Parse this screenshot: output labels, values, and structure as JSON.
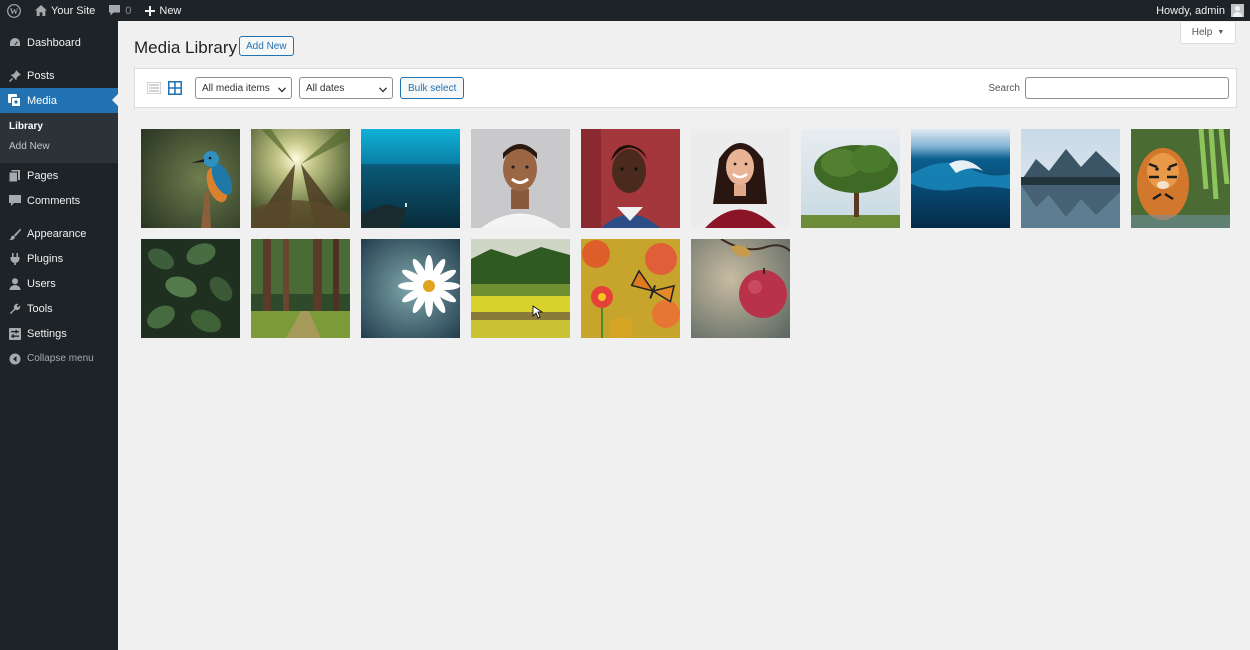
{
  "adminbar": {
    "site_name": "Your Site",
    "comments_count": "0",
    "new_label": "New",
    "howdy": "Howdy, admin"
  },
  "sidebar": {
    "items": [
      {
        "label": "Dashboard",
        "icon": "dashboard-icon"
      },
      {
        "label": "Posts",
        "icon": "pin-icon"
      },
      {
        "label": "Media",
        "icon": "media-icon",
        "active": true
      },
      {
        "label": "Pages",
        "icon": "page-icon"
      },
      {
        "label": "Comments",
        "icon": "comment-icon"
      },
      {
        "label": "Appearance",
        "icon": "brush-icon"
      },
      {
        "label": "Plugins",
        "icon": "plug-icon"
      },
      {
        "label": "Users",
        "icon": "user-icon"
      },
      {
        "label": "Tools",
        "icon": "wrench-icon"
      },
      {
        "label": "Settings",
        "icon": "settings-icon"
      }
    ],
    "submenu": [
      "Library",
      "Add New"
    ],
    "collapse_label": "Collapse menu"
  },
  "main": {
    "title": "Media Library",
    "add_new": "Add New",
    "help": "Help",
    "filter_type": "All media items",
    "filter_date": "All dates",
    "bulk_select": "Bulk select",
    "search_label": "Search",
    "search_value": ""
  },
  "media_items": [
    {
      "subject": "kingfisher"
    },
    {
      "subject": "forest sunburst"
    },
    {
      "subject": "ocean horizon"
    },
    {
      "subject": "smiling man portrait"
    },
    {
      "subject": "woman portrait"
    },
    {
      "subject": "smiling woman red sweater"
    },
    {
      "subject": "tree in field"
    },
    {
      "subject": "ocean wave"
    },
    {
      "subject": "mountain lake reflection"
    },
    {
      "subject": "tiger"
    },
    {
      "subject": "green leaves"
    },
    {
      "subject": "forest path"
    },
    {
      "subject": "white daisy"
    },
    {
      "subject": "green fields"
    },
    {
      "subject": "butterfly on flowers"
    },
    {
      "subject": "red apple"
    }
  ],
  "colors": {
    "admin_bg": "#1d2327",
    "accent": "#2271b1",
    "page_bg": "#f0f0f1"
  }
}
